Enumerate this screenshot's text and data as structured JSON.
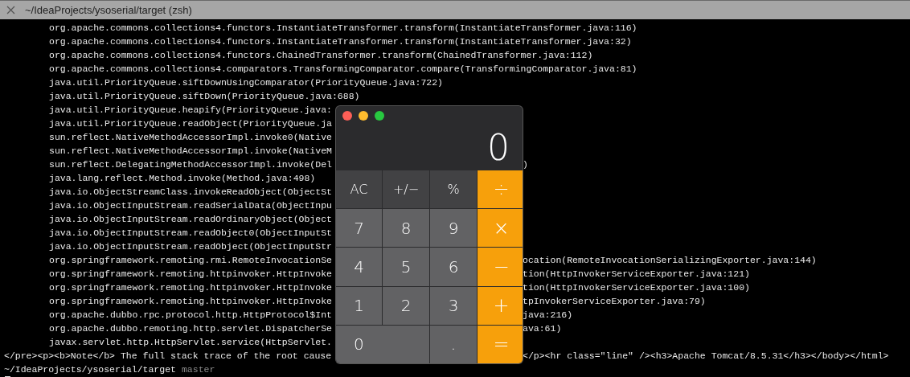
{
  "window": {
    "title": "~/IdeaProjects/ysoserial/target (zsh)"
  },
  "terminal": {
    "lines": [
      {
        "kind": "trace",
        "left": "org.apache.commons.collections4.functors.InstantiateTransformer.transform(InstantiateTransformer.java:116)"
      },
      {
        "kind": "trace",
        "left": "org.apache.commons.collections4.functors.InstantiateTransformer.transform(InstantiateTransformer.java:32)"
      },
      {
        "kind": "trace",
        "left": "org.apache.commons.collections4.functors.ChainedTransformer.transform(ChainedTransformer.java:112)"
      },
      {
        "kind": "trace",
        "left": "org.apache.commons.collections4.comparators.TransformingComparator.compare(TransformingComparator.java:81)"
      },
      {
        "kind": "trace",
        "left": "java.util.PriorityQueue.siftDownUsingComparator(PriorityQueue.java:722)"
      },
      {
        "kind": "trace",
        "left": "java.util.PriorityQueue.siftDown(PriorityQueue.java:688)"
      },
      {
        "kind": "trace",
        "left": "java.util.PriorityQueue.heapify(PriorityQueue.java:"
      },
      {
        "kind": "trace",
        "left": "java.util.PriorityQueue.readObject(PriorityQueue.ja"
      },
      {
        "kind": "trace",
        "left": "sun.reflect.NativeMethodAccessorImpl.invoke0(Native"
      },
      {
        "kind": "trace",
        "left": "sun.reflect.NativeMethodAccessorImpl.invoke(NativeM"
      },
      {
        "kind": "trace",
        "left": "sun.reflect.DelegatingMethodAccessorImpl.invoke(Del",
        "right": ")"
      },
      {
        "kind": "trace",
        "left": "java.lang.reflect.Method.invoke(Method.java:498)"
      },
      {
        "kind": "trace",
        "left": "java.io.ObjectStreamClass.invokeReadObject(ObjectSt"
      },
      {
        "kind": "trace",
        "left": "java.io.ObjectInputStream.readSerialData(ObjectInpu"
      },
      {
        "kind": "trace",
        "left": "java.io.ObjectInputStream.readOrdinaryObject(Object"
      },
      {
        "kind": "trace",
        "left": "java.io.ObjectInputStream.readObject0(ObjectInputSt"
      },
      {
        "kind": "trace",
        "left": "java.io.ObjectInputStream.readObject(ObjectInputStr"
      },
      {
        "kind": "trace",
        "left": "org.springframework.remoting.rmi.RemoteInvocationSe",
        "right": "ocation(RemoteInvocationSerializingExporter.java:144)"
      },
      {
        "kind": "trace",
        "left": "org.springframework.remoting.httpinvoker.HttpInvoke",
        "right": "tion(HttpInvokerServiceExporter.java:121)"
      },
      {
        "kind": "trace",
        "left": "org.springframework.remoting.httpinvoker.HttpInvoke",
        "right": "tion(HttpInvokerServiceExporter.java:100)"
      },
      {
        "kind": "trace",
        "left": "org.springframework.remoting.httpinvoker.HttpInvoke",
        "right": "tpInvokerServiceExporter.java:79)"
      },
      {
        "kind": "trace",
        "left": "org.apache.dubbo.rpc.protocol.http.HttpProtocol$Int",
        "right": "java:216)"
      },
      {
        "kind": "trace",
        "left": "org.apache.dubbo.remoting.http.servlet.DispatcherSe",
        "right": "ava:61)"
      },
      {
        "kind": "trace",
        "left": "javax.servlet.http.HttpServlet.service(HttpServlet."
      },
      {
        "kind": "plain",
        "left": "</pre><p><b>Note</b> The full stack trace of the root cause",
        "right": "</p><hr class=\"line\" /><h3>Apache Tomcat/8.5.31</h3></body></html>"
      }
    ],
    "prompt": {
      "path": "~/IdeaProjects/ysoserial/target",
      "branch": "master"
    }
  },
  "calculator": {
    "display": "0",
    "buttons": [
      {
        "label": "AC",
        "kind": "function"
      },
      {
        "label": "+/−",
        "kind": "function"
      },
      {
        "label": "%",
        "kind": "function"
      },
      {
        "label": "÷",
        "kind": "operator"
      },
      {
        "label": "7",
        "kind": "digit"
      },
      {
        "label": "8",
        "kind": "digit"
      },
      {
        "label": "9",
        "kind": "digit"
      },
      {
        "label": "×",
        "kind": "operator"
      },
      {
        "label": "4",
        "kind": "digit"
      },
      {
        "label": "5",
        "kind": "digit"
      },
      {
        "label": "6",
        "kind": "digit"
      },
      {
        "label": "−",
        "kind": "operator"
      },
      {
        "label": "1",
        "kind": "digit"
      },
      {
        "label": "2",
        "kind": "digit"
      },
      {
        "label": "3",
        "kind": "digit"
      },
      {
        "label": "+",
        "kind": "operator"
      },
      {
        "label": "0",
        "kind": "wide"
      },
      {
        "label": ".",
        "kind": "digit"
      },
      {
        "label": "=",
        "kind": "operator"
      }
    ]
  }
}
